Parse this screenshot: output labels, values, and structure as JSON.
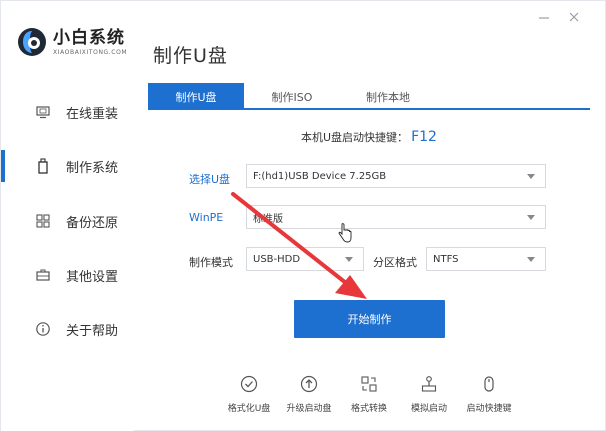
{
  "app": {
    "logo_title": "小白系统",
    "logo_sub": "XIAOBAIXITONG.COM",
    "page_title": "制作U盘"
  },
  "sidebar": {
    "items": [
      {
        "label": "在线重装",
        "icon": "monitor-icon",
        "active": false
      },
      {
        "label": "制作系统",
        "icon": "usb-drive-icon",
        "active": true
      },
      {
        "label": "备份还原",
        "icon": "grid-restore-icon",
        "active": false
      },
      {
        "label": "其他设置",
        "icon": "briefcase-icon",
        "active": false
      },
      {
        "label": "关于帮助",
        "icon": "info-icon",
        "active": false
      }
    ]
  },
  "tabs": [
    {
      "label": "制作U盘",
      "active": true
    },
    {
      "label": "制作ISO",
      "active": false
    },
    {
      "label": "制作本地",
      "active": false
    }
  ],
  "hint": {
    "text": "本机U盘启动快捷键：",
    "key": "F12"
  },
  "form": {
    "select_usb_label": "选择U盘",
    "select_usb_value": "F:(hd1)USB Device 7.25GB",
    "winpe_label": "WinPE",
    "winpe_value": "标准版",
    "mode_label": "制作模式",
    "mode_value": "USB-HDD",
    "partition_label": "分区格式",
    "partition_value": "NTFS"
  },
  "start_button": "开始制作",
  "tools": [
    {
      "label": "格式化U盘",
      "icon": "check-circle-icon"
    },
    {
      "label": "升级启动盘",
      "icon": "upload-circle-icon"
    },
    {
      "label": "格式转换",
      "icon": "convert-icon"
    },
    {
      "label": "模拟启动",
      "icon": "joystick-icon"
    },
    {
      "label": "启动快捷键",
      "icon": "mouse-icon"
    }
  ],
  "colors": {
    "accent": "#1d6fd0",
    "arrow": "#e8373b"
  }
}
